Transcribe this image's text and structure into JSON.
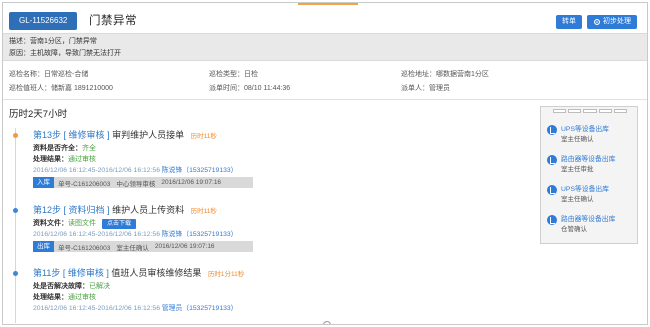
{
  "ticket": {
    "id": "GL-11526632",
    "title": "门禁异常",
    "actions": {
      "transfer": "转单",
      "process": "初步处理"
    }
  },
  "description": {
    "line1": "描述：营南1分区，门禁异常",
    "line2": "原因：主机故障，导致门禁无法打开"
  },
  "info": {
    "inspection_name": "巡检名称：日常巡检-合储",
    "inspection_type": "巡检类型：日检",
    "inspection_address": "巡检地址：哪数据营南1分区",
    "duty_person": "巡检值班人：储新嘉 1891210000",
    "dispatch_time": "派单时间：08/10 11:44:36",
    "dispatcher": "派单人：管理员"
  },
  "elapsed": "历时2天7小时",
  "steps": [
    {
      "step": "第13步",
      "category": "[ 维修审核 ]",
      "desc": "审判维护人员接单",
      "duration": "历时11秒",
      "kv": [
        {
          "k": "资料是否齐全：",
          "v": "齐全"
        },
        {
          "k": "处理结果：",
          "v": "通过审核"
        }
      ],
      "meta_time": "2016/12/06 16:12:45-2016/12/06 16:12:56",
      "meta_who": "陈说锋（15325719133）",
      "tag": "入库",
      "tag_parts": [
        "单号-C161206003",
        "中心领导审核",
        "2016/12/06 19:07:16"
      ]
    },
    {
      "step": "第12步",
      "category": "[ 资料归档 ]",
      "desc": "维护人员上传资料",
      "duration": "历时11秒",
      "kv": [
        {
          "k": "资料文件：",
          "v": "读图文件",
          "btn": "点击下载"
        }
      ],
      "meta_time": "2016/12/06 16:12:45-2016/12/06 16:12:56",
      "meta_who": "陈说锋（15325719133）",
      "tag": "出库",
      "tag_parts": [
        "单号-C161206003",
        "室主任确认",
        "2016/12/06 19:07:16"
      ]
    },
    {
      "step": "第11步",
      "category": "[ 维修审核 ]",
      "desc": "值班人员审核维修结果",
      "duration": "历时1分11秒",
      "kv": [
        {
          "k": "处是否解决故障：",
          "v": "已解决"
        },
        {
          "k": "处理结果：",
          "v": "通过审核"
        }
      ],
      "meta_time": "2016/12/06 16:12:45-2016/12/06 16:12:56",
      "meta_who": "管理员（15325719133）"
    }
  ],
  "side_panel": [
    {
      "title": "UPS等设备出库",
      "sub": "室主任确认"
    },
    {
      "title": "路由器等设备出库",
      "sub": "室主任审批"
    },
    {
      "title": "UPS等设备出库",
      "sub": "室主任确认"
    },
    {
      "title": "路由器等设备出库",
      "sub": "仓管确认"
    }
  ],
  "colors": {
    "primary": "#2f7bd8",
    "accent": "#f29a34",
    "success": "#48a23f"
  }
}
